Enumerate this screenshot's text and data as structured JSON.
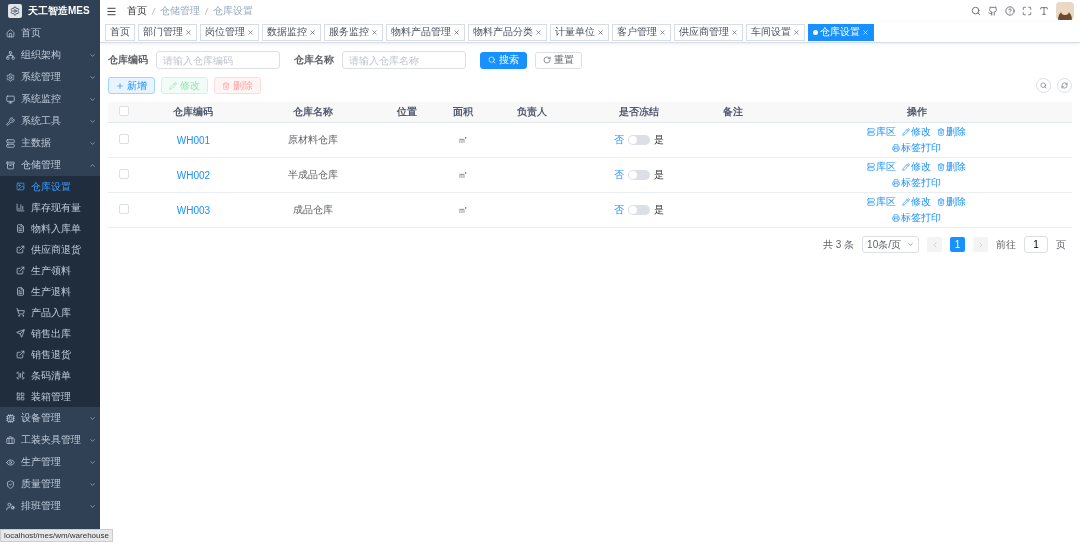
{
  "app": {
    "title": "天工智造MES"
  },
  "sidebar": {
    "items": [
      {
        "label": "首页",
        "kind": "link",
        "selected": false
      },
      {
        "label": "组织架构",
        "kind": "group",
        "expanded": false,
        "selected": false
      },
      {
        "label": "系统管理",
        "kind": "group",
        "expanded": false,
        "selected": false
      },
      {
        "label": "系统监控",
        "kind": "group",
        "expanded": false,
        "selected": false
      },
      {
        "label": "系统工具",
        "kind": "group",
        "expanded": false,
        "selected": false
      },
      {
        "label": "主数据",
        "kind": "group",
        "expanded": false,
        "selected": false
      },
      {
        "label": "仓储管理",
        "kind": "group",
        "expanded": true,
        "selected": false,
        "children": [
          {
            "label": "仓库设置",
            "selected": true
          },
          {
            "label": "库存现有量",
            "selected": false
          },
          {
            "label": "物料入库单",
            "selected": false
          },
          {
            "label": "供应商退货",
            "selected": false
          },
          {
            "label": "生产领料",
            "selected": false
          },
          {
            "label": "生产退料",
            "selected": false
          },
          {
            "label": "产品入库",
            "selected": false
          },
          {
            "label": "销售出库",
            "selected": false
          },
          {
            "label": "销售退货",
            "selected": false
          },
          {
            "label": "条码清单",
            "selected": false
          },
          {
            "label": "装箱管理",
            "selected": false
          }
        ]
      },
      {
        "label": "设备管理",
        "kind": "group",
        "expanded": false,
        "selected": false
      },
      {
        "label": "工装夹具管理",
        "kind": "group",
        "expanded": false,
        "selected": false
      },
      {
        "label": "生产管理",
        "kind": "group",
        "expanded": false,
        "selected": false
      },
      {
        "label": "质量管理",
        "kind": "group",
        "expanded": false,
        "selected": false
      },
      {
        "label": "排班管理",
        "kind": "group",
        "expanded": false,
        "selected": false
      }
    ]
  },
  "breadcrumb": [
    "首页",
    "仓储管理",
    "仓库设置"
  ],
  "tabs": [
    {
      "label": "首页",
      "selected": false,
      "closable": false
    },
    {
      "label": "部门管理",
      "selected": false,
      "closable": true
    },
    {
      "label": "岗位管理",
      "selected": false,
      "closable": true
    },
    {
      "label": "数据监控",
      "selected": false,
      "closable": true
    },
    {
      "label": "服务监控",
      "selected": false,
      "closable": true
    },
    {
      "label": "物料产品管理",
      "selected": false,
      "closable": true
    },
    {
      "label": "物料产品分类",
      "selected": false,
      "closable": true
    },
    {
      "label": "计量单位",
      "selected": false,
      "closable": true
    },
    {
      "label": "客户管理",
      "selected": false,
      "closable": true
    },
    {
      "label": "供应商管理",
      "selected": false,
      "closable": true
    },
    {
      "label": "车间设置",
      "selected": false,
      "closable": true
    },
    {
      "label": "仓库设置",
      "selected": true,
      "closable": true
    }
  ],
  "search": {
    "fields": [
      {
        "label": "仓库编码",
        "placeholder": "请输入仓库编码"
      },
      {
        "label": "仓库名称",
        "placeholder": "请输入仓库名称"
      }
    ],
    "search_button": "搜索",
    "reset_button": "重置"
  },
  "toolbar": [
    {
      "label": "新增",
      "kind": "primary",
      "disabled": false
    },
    {
      "label": "修改",
      "kind": "success",
      "disabled": true
    },
    {
      "label": "删除",
      "kind": "danger",
      "disabled": true
    }
  ],
  "table": {
    "all_checked": false,
    "columns": [
      "仓库编码",
      "仓库名称",
      "位置",
      "面积",
      "负责人",
      "是否冻结",
      "备注",
      "操作"
    ],
    "rows": [
      {
        "checked": false,
        "code": "WH001",
        "name": "原材料仓库",
        "area": "㎡",
        "frozen": false,
        "off_label": "否",
        "on_label": "是",
        "actions": [
          "库区",
          "修改",
          "删除",
          "标签打印"
        ]
      },
      {
        "checked": false,
        "code": "WH002",
        "name": "半成品仓库",
        "area": "㎡",
        "frozen": false,
        "off_label": "否",
        "on_label": "是",
        "actions": [
          "库区",
          "修改",
          "删除",
          "标签打印"
        ]
      },
      {
        "checked": false,
        "code": "WH003",
        "name": "成品仓库",
        "area": "㎡",
        "frozen": false,
        "off_label": "否",
        "on_label": "是",
        "actions": [
          "库区",
          "修改",
          "删除",
          "标签打印"
        ]
      }
    ]
  },
  "pagination": {
    "total": "共 3 条",
    "page_size": "10条/页",
    "pages": [
      {
        "label": "1",
        "selected": true
      }
    ],
    "goto_label": "前往",
    "goto_value": "1",
    "goto_suffix": "页"
  },
  "status_bar": "localhost/mes/wm/warehouse"
}
